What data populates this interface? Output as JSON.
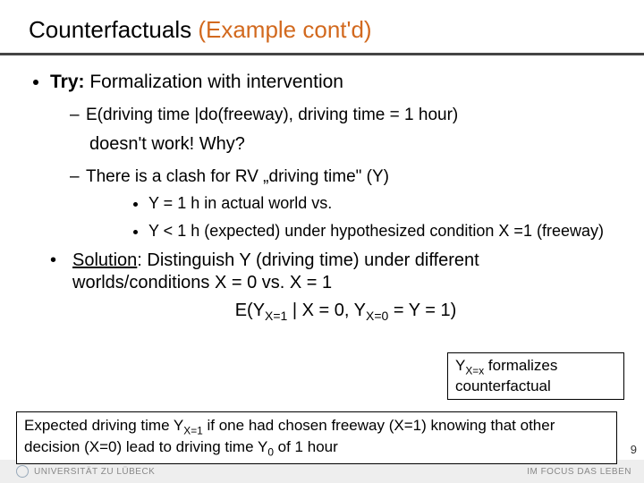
{
  "title_plain": "Counterfactuals ",
  "title_accent": "(Example cont'd)",
  "b1_lead": "Try:",
  "b1_rest": " Formalization with intervention",
  "d1": "E(driving time |do(freeway), driving time = 1 hour)",
  "d1_tail": "doesn't work! Why?",
  "d2": "There is a clash for RV „driving  time\" (Y)",
  "s1": "Y = 1 h in actual world   vs.",
  "s2": "Y < 1 h (expected)  under hypothesized condition X =1 (freeway)",
  "sol_lead": "Solution",
  "sol_rest": ": Distinguish Y (driving time) under different worlds/conditions X = 0 vs. X = 1",
  "eq": "E(Y",
  "eq_sub1": "X=1",
  "eq_mid": " | X = 0, Y",
  "eq_sub2": "X=0",
  "eq_end": " = Y = 1)",
  "co1a": "Y",
  "co1sub": "X=x",
  "co1b": " formalizes counterfactual",
  "co2a": "Expected driving time Y",
  "co2s1": "X=1",
  "co2b": " if one had chosen freeway (X=1) knowing that other decision (X=0) lead to driving time Y",
  "co2s2": "0",
  "co2c": " of 1 hour",
  "footL": "UNIVERSITÄT ZU LÜBECK",
  "footR": "IM FOCUS DAS LEBEN",
  "page": "9"
}
